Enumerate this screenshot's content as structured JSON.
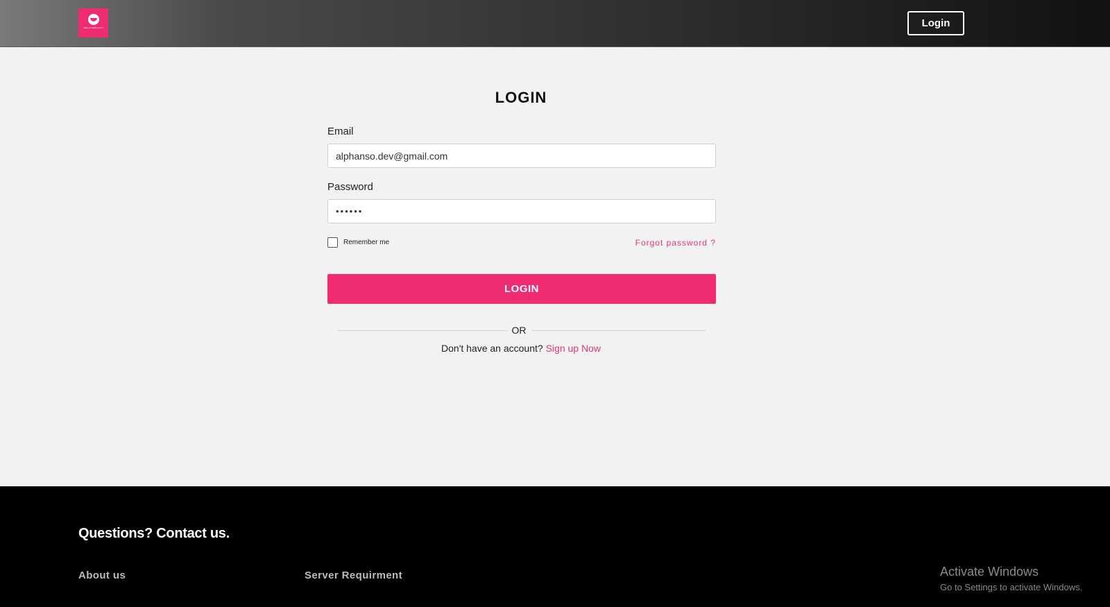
{
  "header": {
    "logo_text": "Make In Match Learn",
    "login_label": "Login"
  },
  "form": {
    "title": "LOGIN",
    "email_label": "Email",
    "email_value": "alphanso.dev@gmail.com",
    "password_label": "Password",
    "password_value": "••••••",
    "remember_label": "Remember me",
    "forgot_label": "Forgot password ?",
    "submit_label": "LOGIN",
    "or_label": "OR",
    "no_account_text": "Don't have an account? ",
    "signup_label": "Sign up Now"
  },
  "footer": {
    "title": "Questions? Contact us.",
    "links": [
      "About us",
      "Server Requirment"
    ]
  },
  "watermark": {
    "title": "Activate Windows",
    "subtitle": "Go to Settings to activate Windows."
  },
  "colors": {
    "accent": "#ef2b72",
    "footer_bg": "#000000",
    "page_bg": "#f2f2f2"
  }
}
